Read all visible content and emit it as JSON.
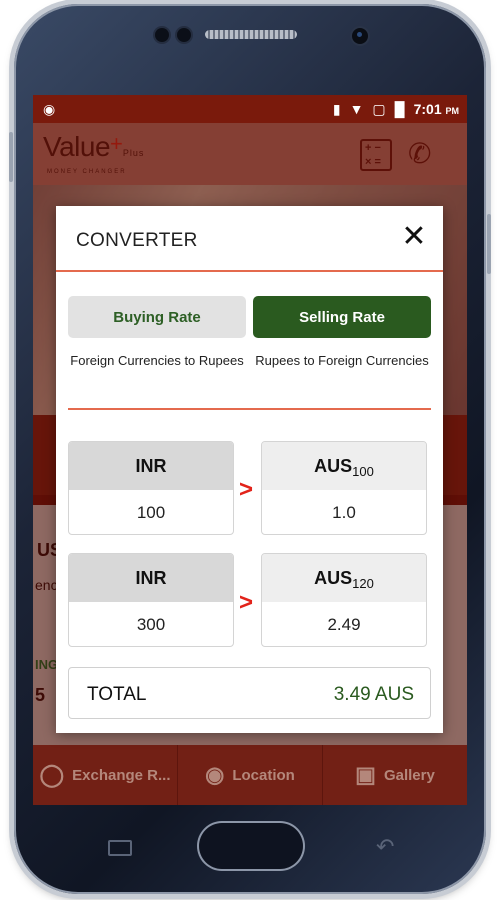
{
  "statusbar": {
    "time": "7:01",
    "ampm": "PM",
    "icons": [
      "android-icon",
      "vibrate-icon",
      "wifi-icon",
      "no-sim-icon",
      "battery-icon"
    ]
  },
  "app": {
    "logo_text": "Value",
    "logo_plus": "+",
    "logo_sub": "Plus",
    "logo_tag": "MONEY CHANGER"
  },
  "background": {
    "card_left_text": "US",
    "card_left_sub": "enc",
    "card_left_bottom": "5",
    "card_left_label": "ING"
  },
  "bottom_nav": {
    "items": [
      {
        "label": "Exchange R...",
        "icon": "exchange-icon"
      },
      {
        "label": "Location",
        "icon": "location-pin-icon"
      },
      {
        "label": "Gallery",
        "icon": "gallery-icon"
      }
    ]
  },
  "dialog": {
    "title": "CONVERTER",
    "buying_label": "Buying Rate",
    "selling_label": "Selling Rate",
    "buying_desc": "Foreign Currencies to Rupees",
    "selling_desc": "Rupees to Foreign Currencies",
    "selected_tab": "Selling Rate",
    "rows": [
      {
        "from_currency": "INR",
        "from_value": "100",
        "to_currency": "AUS",
        "to_rate": "100",
        "to_value": "1.0"
      },
      {
        "from_currency": "INR",
        "from_value": "300",
        "to_currency": "AUS",
        "to_rate": "120",
        "to_value": "2.49"
      }
    ],
    "arrow": ">",
    "total_label": "TOTAL",
    "total_value": "3.49 AUS"
  },
  "colors": {
    "accent_green": "#2a5a1f",
    "accent_red": "#e2231a",
    "brand_maroon": "#7a1a0c"
  }
}
